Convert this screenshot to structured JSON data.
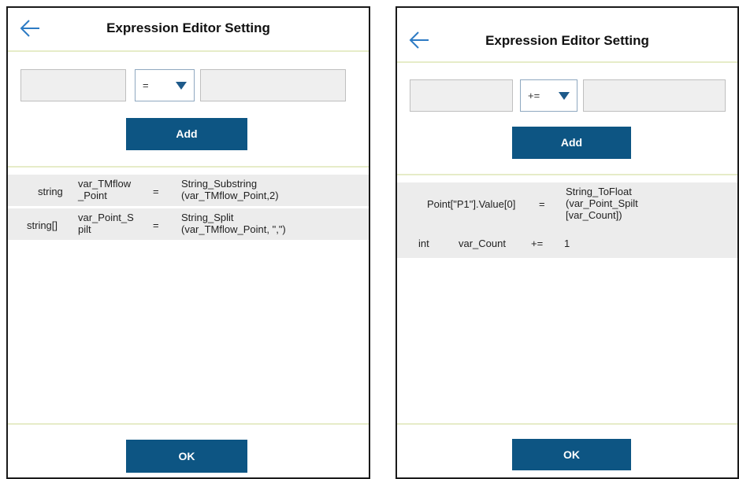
{
  "left_panel": {
    "title": "Expression Editor Setting",
    "operator": "=",
    "add_label": "Add",
    "ok_label": "OK",
    "rows": [
      {
        "type": "string",
        "name": "var_TMflow\n_Point",
        "op": "=",
        "value": "String_Substring\n(var_TMflow_Point,2)"
      },
      {
        "type": "string[]",
        "name": "var_Point_S\npilt",
        "op": "=",
        "value": "String_Split\n(var_TMflow_Point, \",\")"
      }
    ]
  },
  "right_panel": {
    "title": "Expression Editor Setting",
    "operator": "+=",
    "add_label": "Add",
    "ok_label": "OK",
    "rows": [
      {
        "target": "Point[\"P1\"].Value[0]",
        "op": "=",
        "value": "String_ToFloat\n(var_Point_Spilt\n[var_Count])"
      },
      {
        "type": "int",
        "name": "var_Count",
        "op": "+=",
        "value": "1"
      }
    ]
  },
  "icons": {
    "back": "arrow-left-icon",
    "dropdown": "caret-down-icon"
  },
  "colors": {
    "accent": "#0d5583",
    "divider": "#e6ecc8",
    "row_bg": "#ececec"
  }
}
